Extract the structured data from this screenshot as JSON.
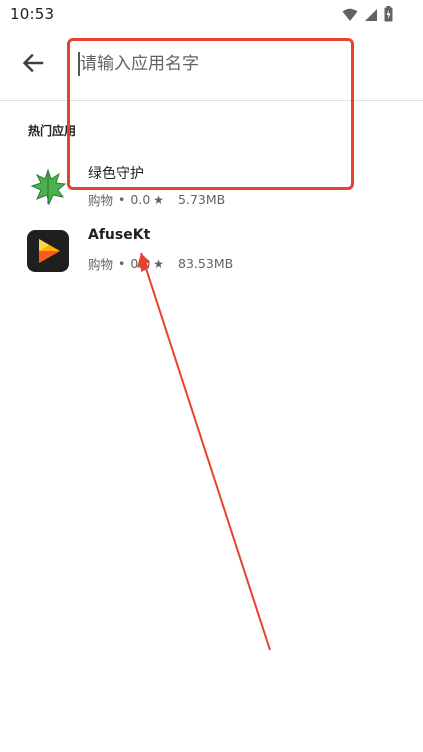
{
  "status_bar": {
    "time": "10:53",
    "icons": [
      "wifi-icon",
      "signal-icon",
      "battery-charging-icon"
    ]
  },
  "search": {
    "back_icon": "arrow-left-icon",
    "placeholder": "请输入应用名字",
    "value": ""
  },
  "section": {
    "title": "热门应用"
  },
  "apps": [
    {
      "name": "绿色守护",
      "category": "购物",
      "separator": "•",
      "rating": "0.0",
      "star": "★",
      "size": "5.73MB",
      "icon": "green-leaf-icon"
    },
    {
      "name": "AfuseKt",
      "category": "购物",
      "separator": "•",
      "rating": "0.0",
      "star": "★",
      "size": "83.53MB",
      "icon": "play-triangle-icon"
    }
  ],
  "annotation": {
    "color": "#e8412e"
  }
}
